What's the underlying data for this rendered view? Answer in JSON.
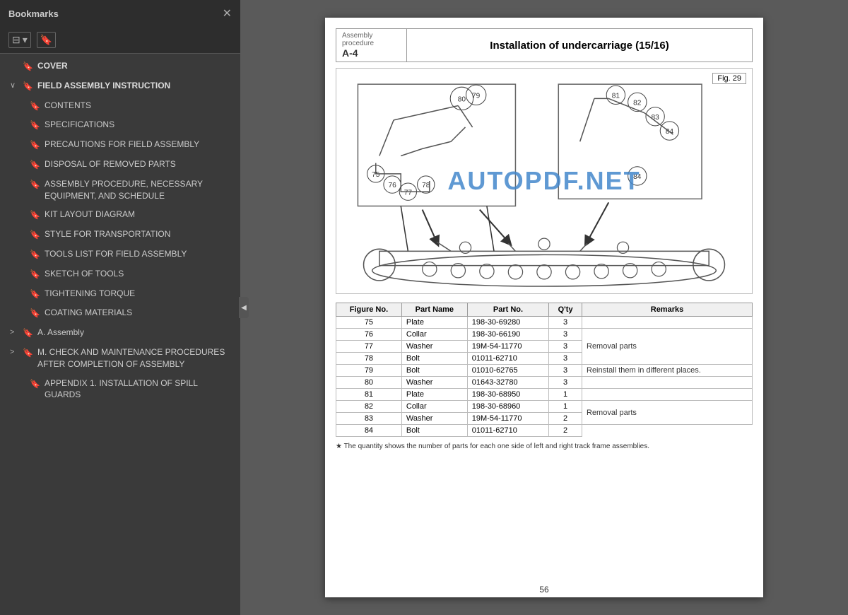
{
  "sidebar": {
    "title": "Bookmarks",
    "close_label": "✕",
    "items": [
      {
        "id": "cover",
        "label": "COVER",
        "level": 0,
        "has_arrow": false,
        "expanded": false
      },
      {
        "id": "field-assembly",
        "label": "FIELD ASSEMBLY INSTRUCTION",
        "level": 0,
        "has_arrow": true,
        "expanded": true,
        "arrow": "∨"
      },
      {
        "id": "contents",
        "label": "CONTENTS",
        "level": 1,
        "has_arrow": false
      },
      {
        "id": "specifications",
        "label": "SPECIFICATIONS",
        "level": 1,
        "has_arrow": false
      },
      {
        "id": "precautions",
        "label": "PRECAUTIONS FOR FIELD ASSEMBLY",
        "level": 1,
        "has_arrow": false
      },
      {
        "id": "disposal",
        "label": "DISPOSAL OF REMOVED PARTS",
        "level": 1,
        "has_arrow": false
      },
      {
        "id": "assembly-procedure",
        "label": "ASSEMBLY PROCEDURE, NECESSARY EQUIPMENT, AND SCHEDULE",
        "level": 1,
        "has_arrow": false
      },
      {
        "id": "kit-layout",
        "label": "KIT LAYOUT DIAGRAM",
        "level": 1,
        "has_arrow": false
      },
      {
        "id": "style-transport",
        "label": "STYLE FOR TRANSPORTATION",
        "level": 1,
        "has_arrow": false
      },
      {
        "id": "tools-list",
        "label": "TOOLS LIST FOR FIELD ASSEMBLY",
        "level": 1,
        "has_arrow": false
      },
      {
        "id": "sketch-tools",
        "label": "SKETCH OF TOOLS",
        "level": 1,
        "has_arrow": false
      },
      {
        "id": "tightening",
        "label": "TIGHTENING TORQUE",
        "level": 1,
        "has_arrow": false
      },
      {
        "id": "coating",
        "label": "COATING MATERIALS",
        "level": 1,
        "has_arrow": false
      },
      {
        "id": "a-assembly",
        "label": "A. Assembly",
        "level": 0,
        "has_arrow": true,
        "expanded": false,
        "arrow": ">"
      },
      {
        "id": "m-check",
        "label": "M. CHECK AND MAINTENANCE PROCEDURES AFTER COMPLETION OF ASSEMBLY",
        "level": 0,
        "has_arrow": true,
        "expanded": false,
        "arrow": ">"
      },
      {
        "id": "appendix",
        "label": "APPENDIX 1. INSTALLATION OF SPILL GUARDS",
        "level": 1,
        "has_arrow": false
      }
    ]
  },
  "doc": {
    "header_section_label": "Assembly procedure",
    "header_section_value": "A-4",
    "title": "Installation of undercarriage (15/16)",
    "fig_label": "Fig. 29",
    "watermark": "AUTOPDF.NET",
    "footnote": "★  The quantity shows the number of parts for each one side of left and right track frame assemblies.",
    "page_number": "56"
  },
  "parts_table": {
    "columns": [
      "Figure No.",
      "Part Name",
      "Part No.",
      "Q'ty",
      "Remarks"
    ],
    "rows": [
      {
        "fig": "75",
        "name": "Plate",
        "part": "198-30-69280",
        "qty": "3",
        "remark": ""
      },
      {
        "fig": "76",
        "name": "Collar",
        "part": "198-30-66190",
        "qty": "3",
        "remark": "Removal parts"
      },
      {
        "fig": "77",
        "name": "Washer",
        "part": "19M-54-11770",
        "qty": "3",
        "remark": ""
      },
      {
        "fig": "78",
        "name": "Bolt",
        "part": "01011-62710",
        "qty": "3",
        "remark": ""
      },
      {
        "fig": "79",
        "name": "Bolt",
        "part": "01010-62765",
        "qty": "3",
        "remark": "Reinstall them in different places."
      },
      {
        "fig": "80",
        "name": "Washer",
        "part": "01643-32780",
        "qty": "3",
        "remark": ""
      },
      {
        "fig": "81",
        "name": "Plate",
        "part": "198-30-68950",
        "qty": "1",
        "remark": ""
      },
      {
        "fig": "82",
        "name": "Collar",
        "part": "198-30-68960",
        "qty": "1",
        "remark": "Removal parts"
      },
      {
        "fig": "83",
        "name": "Washer",
        "part": "19M-54-11770",
        "qty": "2",
        "remark": ""
      },
      {
        "fig": "84",
        "name": "Bolt",
        "part": "01011-62710",
        "qty": "2",
        "remark": ""
      }
    ]
  }
}
